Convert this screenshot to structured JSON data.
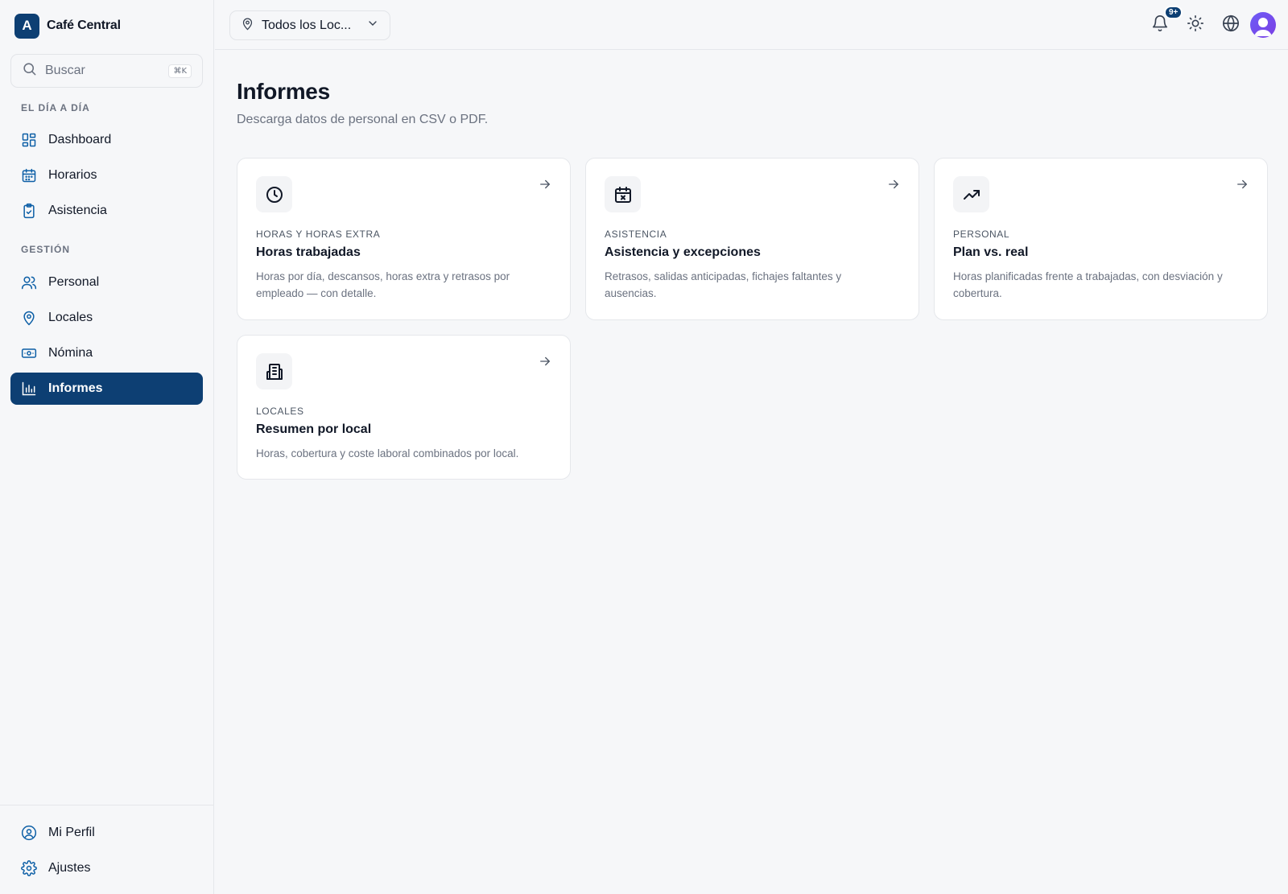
{
  "brand": {
    "logo_letter": "A",
    "name": "Café Central"
  },
  "search": {
    "placeholder": "Buscar",
    "shortcut": "⌘K"
  },
  "sidebar": {
    "sections": [
      {
        "title": "EL DÍA A DÍA"
      },
      {
        "title": "GESTIÓN"
      }
    ],
    "items": [
      {
        "label": "Dashboard",
        "icon": "dashboard-icon"
      },
      {
        "label": "Horarios",
        "icon": "calendar-icon"
      },
      {
        "label": "Asistencia",
        "icon": "clipboard-check-icon"
      },
      {
        "label": "Personal",
        "icon": "users-icon"
      },
      {
        "label": "Locales",
        "icon": "map-pin-icon"
      },
      {
        "label": "Nómina",
        "icon": "banknote-icon"
      },
      {
        "label": "Informes",
        "icon": "bar-chart-icon",
        "active": true
      }
    ],
    "bottom_items": [
      {
        "label": "Mi Perfil",
        "icon": "user-circle-icon"
      },
      {
        "label": "Ajustes",
        "icon": "settings-icon"
      }
    ]
  },
  "topbar": {
    "location_select": "Todos los Loc...",
    "notifications_badge": "9+"
  },
  "main": {
    "title": "Informes",
    "subtitle": "Descarga datos de personal en CSV o PDF.",
    "cards": [
      {
        "category": "HORAS Y HORAS EXTRA",
        "title": "Horas trabajadas",
        "description": "Horas por día, descansos, horas extra y retrasos por empleado — con detalle.",
        "icon": "clock-icon"
      },
      {
        "category": "ASISTENCIA",
        "title": "Asistencia y excepciones",
        "description": "Retrasos, salidas anticipadas, fichajes faltantes y ausencias.",
        "icon": "calendar-x-icon"
      },
      {
        "category": "PERSONAL",
        "title": "Plan vs. real",
        "description": "Horas planificadas frente a trabajadas, con desviación y cobertura.",
        "icon": "trending-up-icon"
      },
      {
        "category": "LOCALES",
        "title": "Resumen por local",
        "description": "Horas, cobertura y coste laboral combinados por local.",
        "icon": "building-icon"
      }
    ]
  },
  "colors": {
    "accent": "#0d3f73",
    "background": "#f6f7f9",
    "sidebar_icon": "#0d5fa6"
  }
}
